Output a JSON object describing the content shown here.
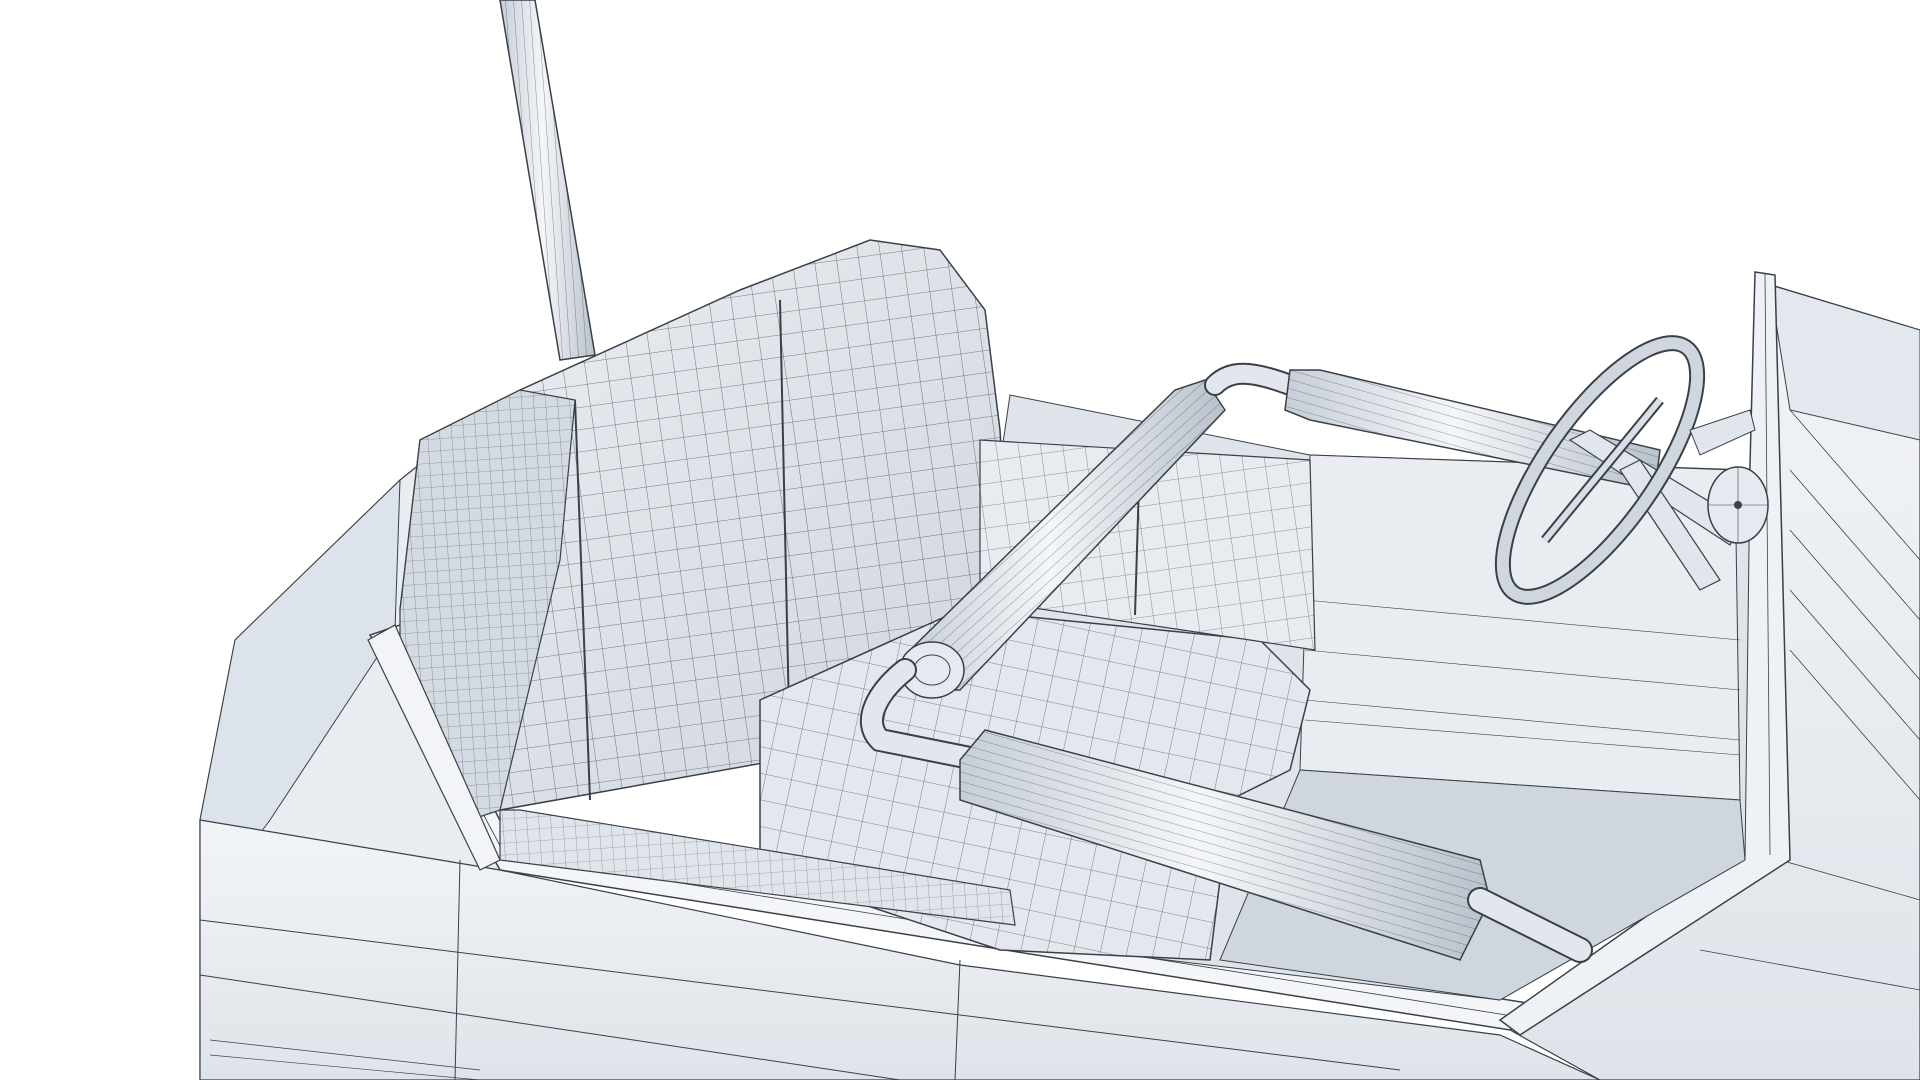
{
  "scene": {
    "subject": "bumper-car-wireframe-render",
    "colors": {
      "background": "#ffffff",
      "body_light": "#eef1f5",
      "body_mid": "#dde3ea",
      "body_shadow": "#c9d0d9",
      "seat_light": "#e6eaf0",
      "seat_mid": "#d3d9e1",
      "wire": "#3a4048",
      "wire_faint": "#6b737d"
    }
  }
}
